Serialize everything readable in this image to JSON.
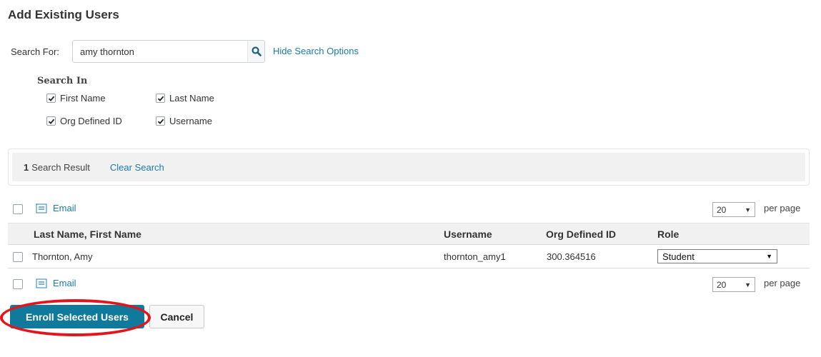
{
  "page": {
    "title": "Add Existing Users"
  },
  "search": {
    "label": "Search For:",
    "value": "amy thornton",
    "hide_options_label": "Hide Search Options",
    "search_in_heading": "Search In",
    "options": [
      {
        "label": "First Name",
        "checked": true
      },
      {
        "label": "Last Name",
        "checked": true
      },
      {
        "label": "Org Defined ID",
        "checked": true
      },
      {
        "label": "Username",
        "checked": true
      }
    ]
  },
  "results": {
    "count": "1",
    "count_word": "Search Result",
    "clear_label": "Clear Search"
  },
  "toolbar": {
    "email_label": "Email",
    "per_page_value": "20",
    "per_page_label": "per page"
  },
  "table": {
    "headers": {
      "name": "Last Name, First Name",
      "username": "Username",
      "org_id": "Org Defined ID",
      "role": "Role"
    },
    "rows": [
      {
        "name": "Thornton, Amy",
        "username": "thornton_amy1",
        "org_id": "300.364516",
        "role": "Student"
      }
    ]
  },
  "actions": {
    "enroll_label": "Enroll Selected Users",
    "cancel_label": "Cancel"
  },
  "colors": {
    "link": "#1a7bb0",
    "primary_button": "#0f7a9b",
    "highlight": "#e3151a"
  }
}
